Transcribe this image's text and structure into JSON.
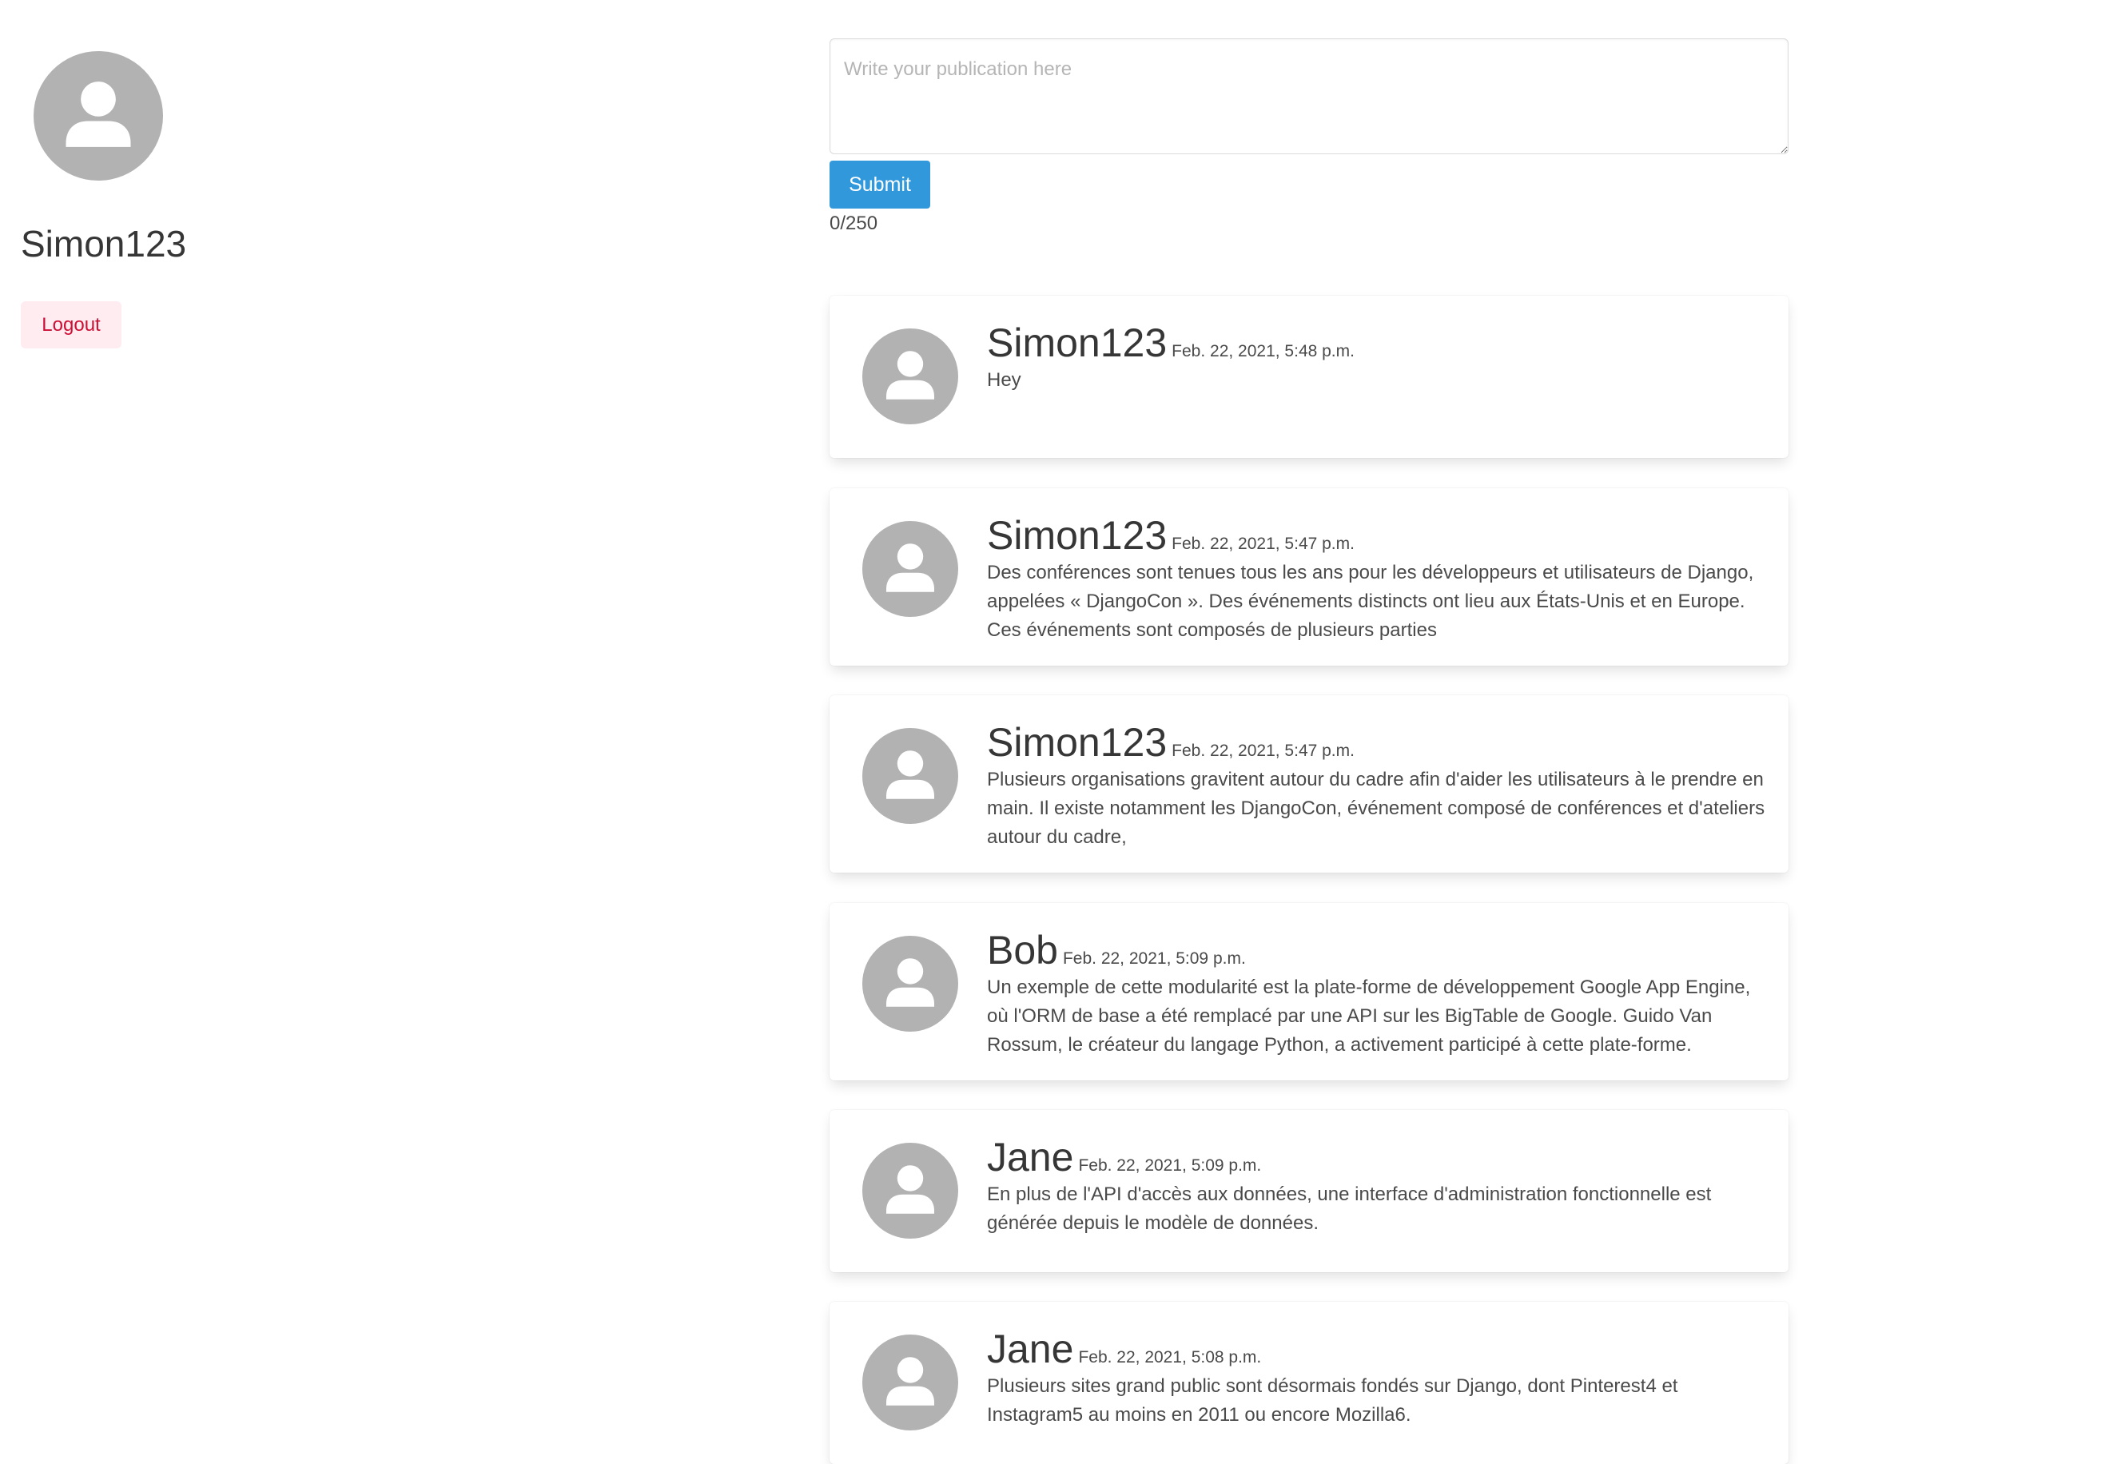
{
  "profile": {
    "username": "Simon123",
    "logout_label": "Logout",
    "avatar_icon": "user-avatar-icon"
  },
  "composer": {
    "placeholder": "Write your publication here",
    "value": "",
    "submit_label": "Submit",
    "char_count": "0/250"
  },
  "posts": [
    {
      "author": "Simon123",
      "date": "Feb. 22, 2021, 5:48 p.m.",
      "text": "Hey"
    },
    {
      "author": "Simon123",
      "date": "Feb. 22, 2021, 5:47 p.m.",
      "text": "Des conférences sont tenues tous les ans pour les développeurs et utilisateurs de Django, appelées « DjangoCon ». Des événements distincts ont lieu aux États-Unis et en Europe. Ces événements sont composés de plusieurs parties"
    },
    {
      "author": "Simon123",
      "date": "Feb. 22, 2021, 5:47 p.m.",
      "text": "Plusieurs organisations gravitent autour du cadre afin d'aider les utilisateurs à le prendre en main. Il existe notamment les DjangoCon, événement composé de conférences et d'ateliers autour du cadre,"
    },
    {
      "author": "Bob",
      "date": "Feb. 22, 2021, 5:09 p.m.",
      "text": "Un exemple de cette modularité est la plate-forme de développement Google App Engine, où l'ORM de base a été remplacé par une API sur les BigTable de Google. Guido Van Rossum, le créateur du langage Python, a activement participé à cette plate-forme."
    },
    {
      "author": "Jane",
      "date": "Feb. 22, 2021, 5:09 p.m.",
      "text": "En plus de l'API d'accès aux données, une interface d'administration fonctionnelle est générée depuis le modèle de données."
    },
    {
      "author": "Jane",
      "date": "Feb. 22, 2021, 5:08 p.m.",
      "text": "Plusieurs sites grand public sont désormais fondés sur Django, dont Pinterest4 et Instagram5 au moins en 2011 ou encore Mozilla6."
    }
  ]
}
